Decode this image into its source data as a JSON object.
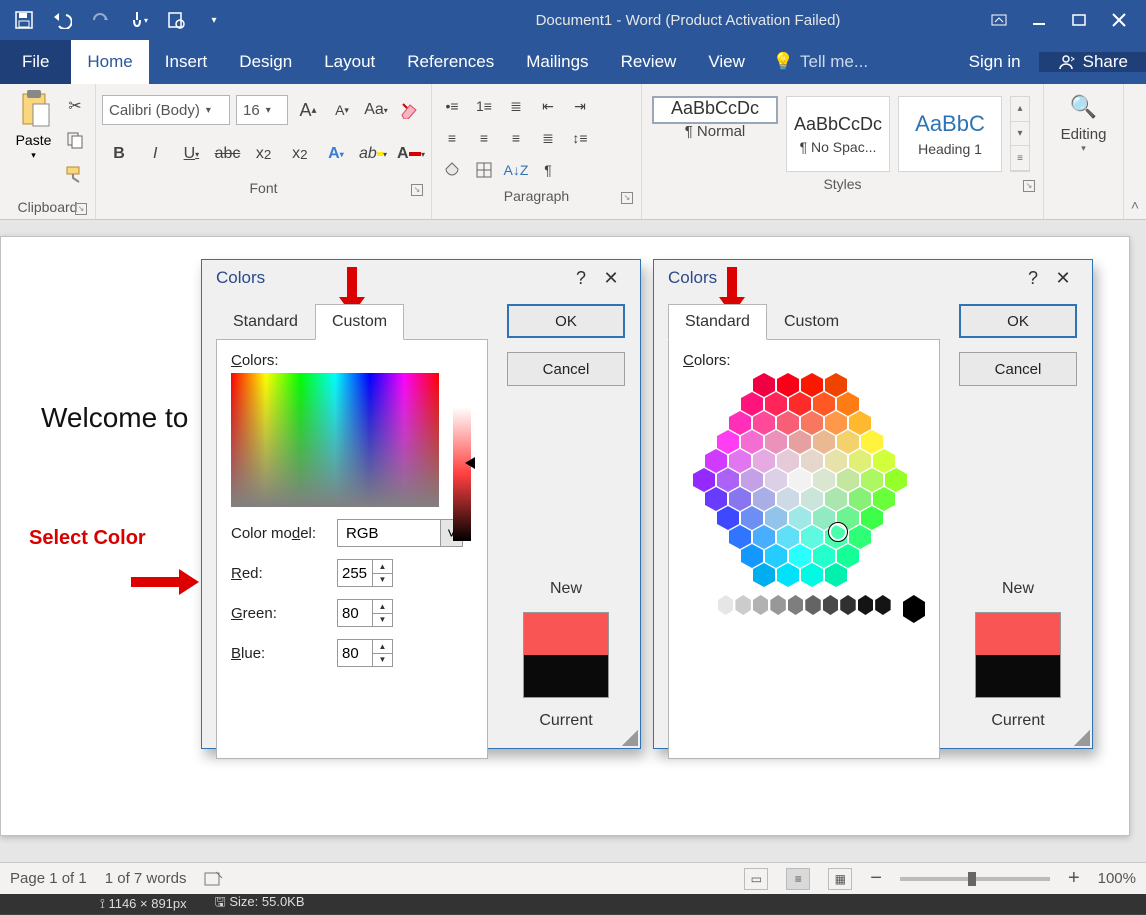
{
  "title": "Document1 - Word (Product Activation Failed)",
  "tabs": {
    "file": "File",
    "home": "Home",
    "insert": "Insert",
    "design": "Design",
    "layout": "Layout",
    "references": "References",
    "mailings": "Mailings",
    "review": "Review",
    "view": "View",
    "tellme": "Tell me...",
    "signin": "Sign in",
    "share": "Share"
  },
  "ribbon": {
    "clipboard": {
      "label": "Clipboard",
      "paste": "Paste"
    },
    "font": {
      "label": "Font",
      "name": "Calibri (Body)",
      "size": "16",
      "aa": "Aa"
    },
    "paragraph": {
      "label": "Paragraph"
    },
    "styles": {
      "label": "Styles",
      "items": [
        {
          "sample": "AaBbCcDc",
          "name": "¶ Normal"
        },
        {
          "sample": "AaBbCcDc",
          "name": "¶ No Spac..."
        },
        {
          "sample": "AaBbC",
          "name": "Heading 1"
        }
      ]
    },
    "editing": {
      "label": "Editing"
    }
  },
  "document": {
    "text": "Welcome to"
  },
  "annotation": {
    "label": "Select Color"
  },
  "dialog_custom": {
    "title": "Colors",
    "tab_standard": "Standard",
    "tab_custom": "Custom",
    "colors_label": "Colors:",
    "model_label": "Color model:",
    "model_value": "RGB",
    "red_label": "Red:",
    "red_value": "255",
    "green_label": "Green:",
    "green_value": "80",
    "blue_label": "Blue:",
    "blue_value": "80",
    "ok": "OK",
    "cancel": "Cancel",
    "new": "New",
    "current": "Current",
    "new_color": "#fa5555",
    "current_color": "#0a0a0a"
  },
  "dialog_standard": {
    "title": "Colors",
    "tab_standard": "Standard",
    "tab_custom": "Custom",
    "colors_label": "Colors:",
    "ok": "OK",
    "cancel": "Cancel",
    "new": "New",
    "current": "Current",
    "new_color": "#fa5555",
    "current_color": "#0a0a0a"
  },
  "statusbar": {
    "page": "Page 1 of 1",
    "words": "1 of 7 words",
    "zoom": "100%",
    "minus": "−",
    "plus": "+"
  },
  "infostrip": {
    "dims": "1146 × 891px",
    "size": "Size: 55.0KB"
  }
}
